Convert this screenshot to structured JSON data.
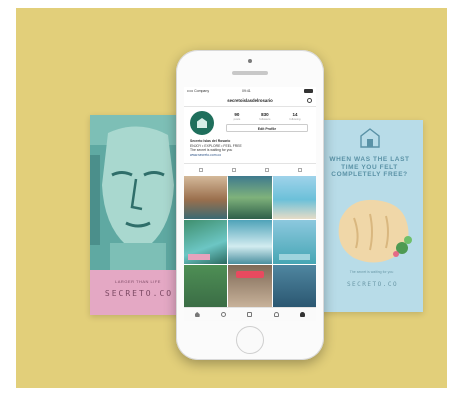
{
  "background_color": "#e2cf7a",
  "left_poster": {
    "small_text": "LARGER THAN LIFE",
    "brand": "SECRETO.CO"
  },
  "right_poster": {
    "question": "WHEN WAS THE LAST TIME YOU FELT COMPLETELY FREE?",
    "tag": "The secret is waiting for you",
    "brand": "SECRETO.CO"
  },
  "phone": {
    "status": {
      "carrier": "••••• Company",
      "time": "09:41"
    },
    "username": "secretoislasdelrosario",
    "stats": [
      {
        "value": "90",
        "label": "posts"
      },
      {
        "value": "830",
        "label": "followers"
      },
      {
        "value": "14",
        "label": "following"
      }
    ],
    "edit_profile_label": "Edit Profile",
    "bio": {
      "name": "Secreto Islas del Rosario",
      "line1": "ENJOY • EXPLORE • FEEL FREE",
      "line2": "The secret is waiting for you",
      "url": "www.secreto.com.co"
    }
  }
}
